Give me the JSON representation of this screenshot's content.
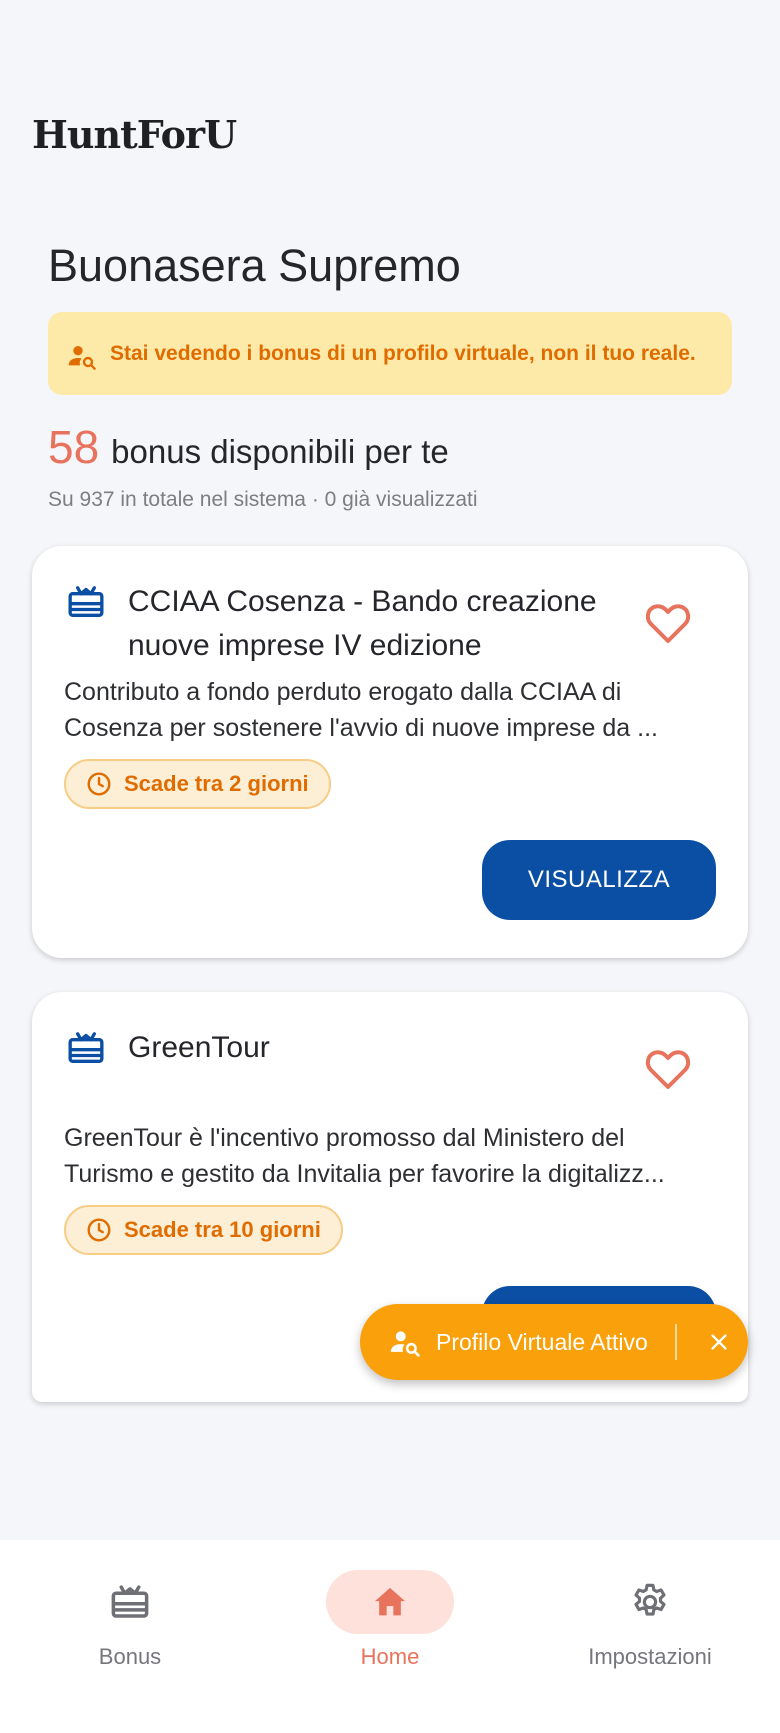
{
  "app": {
    "title": "HuntForU"
  },
  "greeting": "Buonasera Supremo",
  "banner": {
    "icon": "user-search-icon",
    "text": "Stai vedendo i bonus di un profilo virtuale, non il tuo reale."
  },
  "summary": {
    "count": "58",
    "count_text": "bonus disponibili per te",
    "totals": "Su 937 in totale nel sistema · 0 già visualizzati"
  },
  "bonuses": [
    {
      "title": "CCIAA Cosenza - Bando creazione nuove imprese IV edizione",
      "desc_line1": "Contributo a fondo perduto erogato dalla CCIAA di",
      "desc_line2": "Cosenza per sostenere l'avvio di nuove imprese da ...",
      "deadline": "Scade tra 2 giorni",
      "button": "VISUALIZZA"
    },
    {
      "title": "GreenTour",
      "desc_line1": "GreenTour è l'incentivo promosso dal Ministero del",
      "desc_line2": "Turismo e gestito da Invitalia per favorire la digitalizz...",
      "deadline": "Scade tra 10 giorni",
      "button": "VISUALIZZA"
    }
  ],
  "fab": {
    "label": "Profilo Virtuale Attivo"
  },
  "nav": {
    "bonus": "Bonus",
    "home": "Home",
    "settings": "Impostazioni",
    "active": "home"
  },
  "colors": {
    "accent": "#e8735d",
    "primary_button": "#0a4fa3",
    "warning": "#f9a00a",
    "banner_bg": "#fdeaa9",
    "banner_text": "#e06c00"
  }
}
